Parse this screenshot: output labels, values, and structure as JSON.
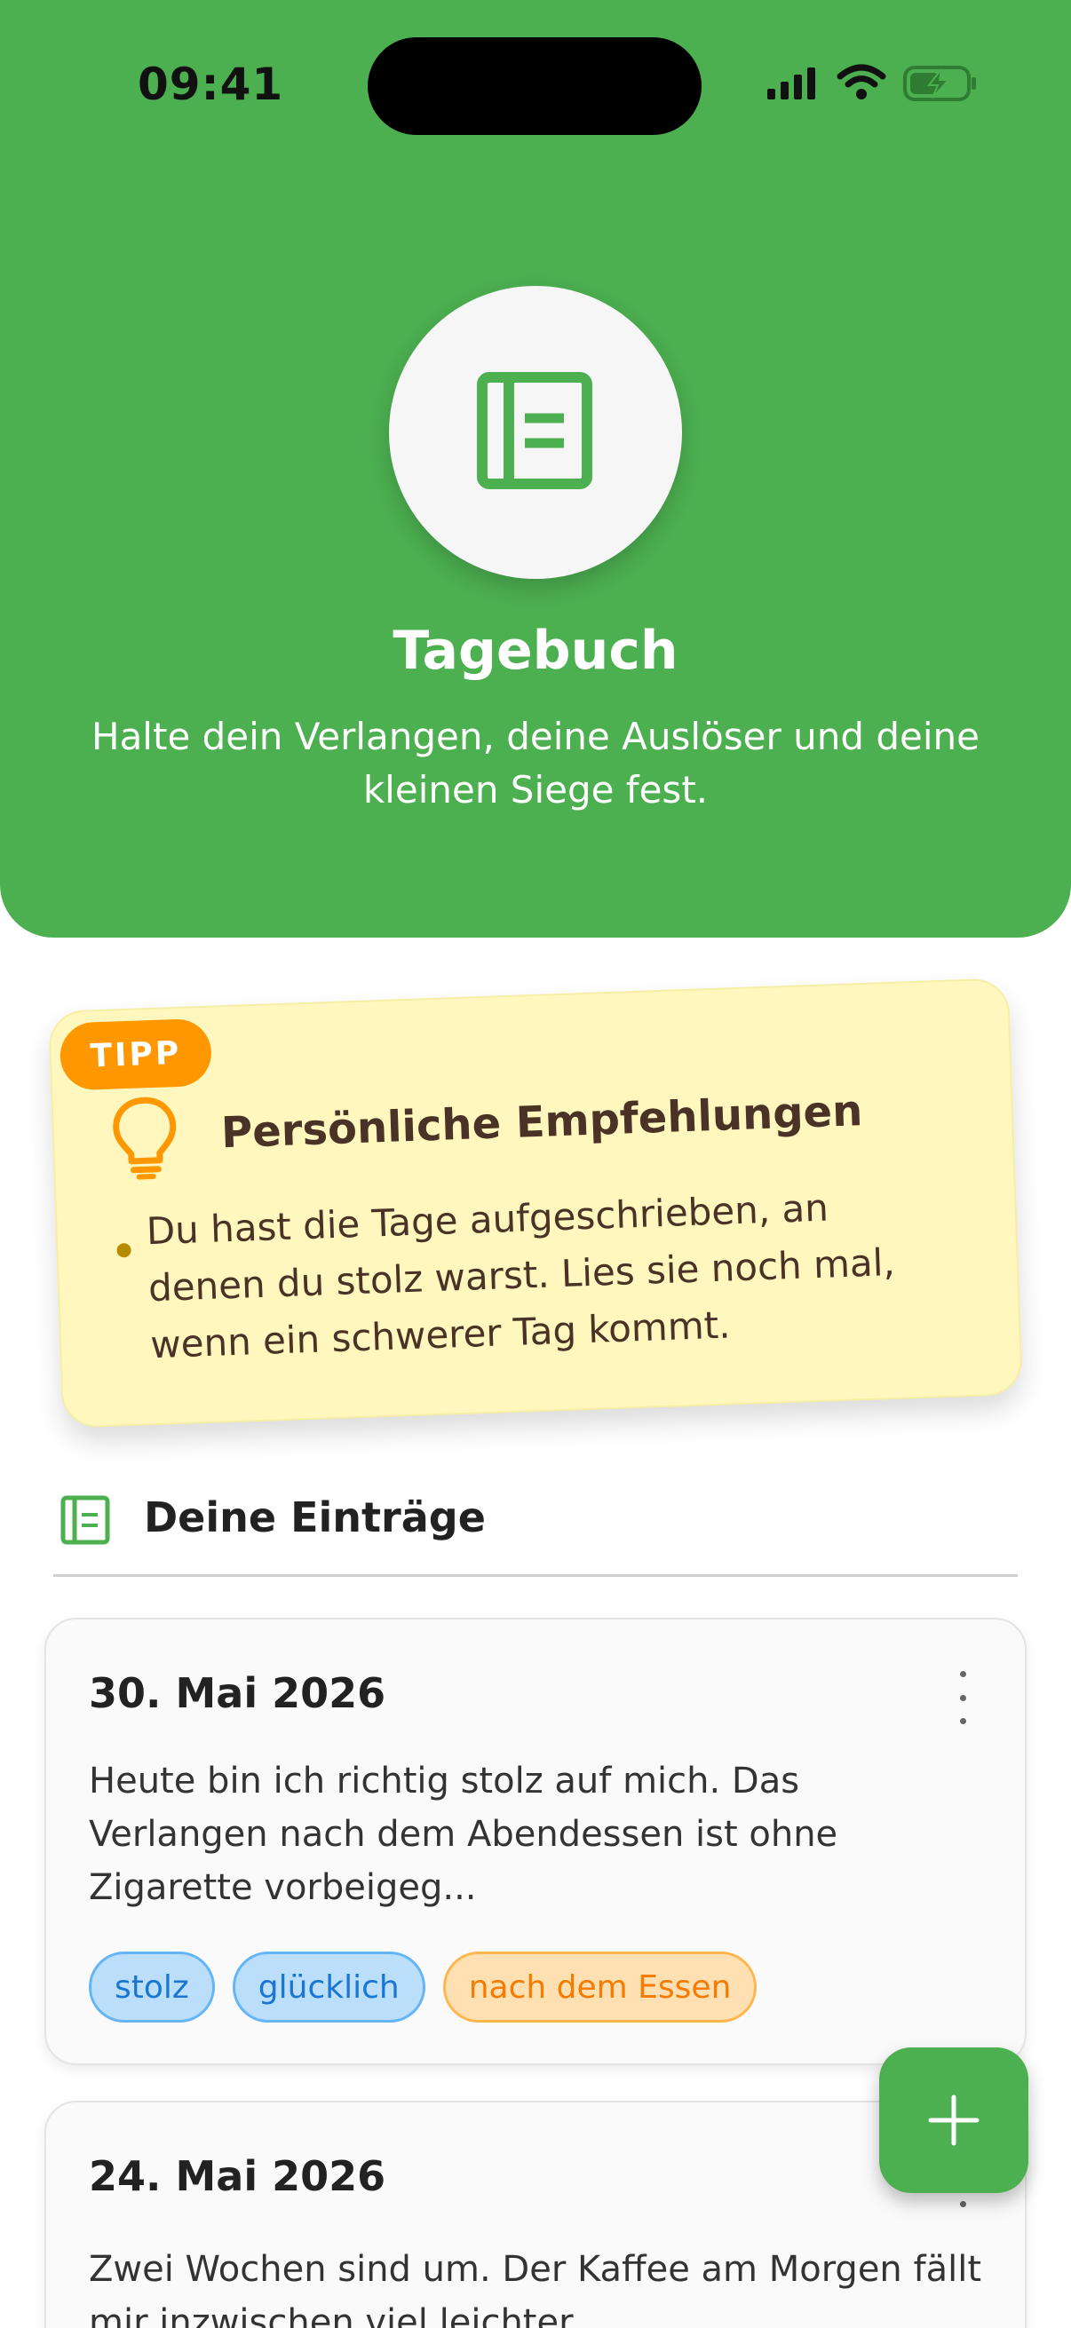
{
  "status_bar": {
    "time": "09:41"
  },
  "header": {
    "title": "Tagebuch",
    "subtitle": "Halte dein Verlangen, deine Auslöser und deine kleinen Siege fest.",
    "icon": "journal-icon"
  },
  "tip": {
    "badge": "TIPP",
    "title": "Persönliche Empfehlungen",
    "items": [
      "Du hast die Tage aufgeschrieben, an denen du stolz warst. Lies sie noch mal, wenn ein schwerer Tag kommt."
    ]
  },
  "entries_section": {
    "title": "Deine Einträge"
  },
  "entries": [
    {
      "date": "30. Mai 2026",
      "text": "Heute bin ich richtig stolz auf mich. Das Verlangen nach dem Abendessen ist ohne Zigarette vorbeigeg...",
      "tags": [
        {
          "label": "stolz",
          "color": "blue"
        },
        {
          "label": "glücklich",
          "color": "blue"
        },
        {
          "label": "nach dem Essen",
          "color": "orange"
        }
      ]
    },
    {
      "date": "24. Mai 2026",
      "text": "Zwei Wochen sind um. Der Kaffee am Morgen fällt mir inzwischen viel leichter."
    }
  ],
  "colors": {
    "primary": "#4caf50",
    "tip_background": "#fff7be",
    "badge": "#ff9800",
    "tag_blue": "#bbdefb",
    "tag_orange": "#ffe0b2"
  }
}
